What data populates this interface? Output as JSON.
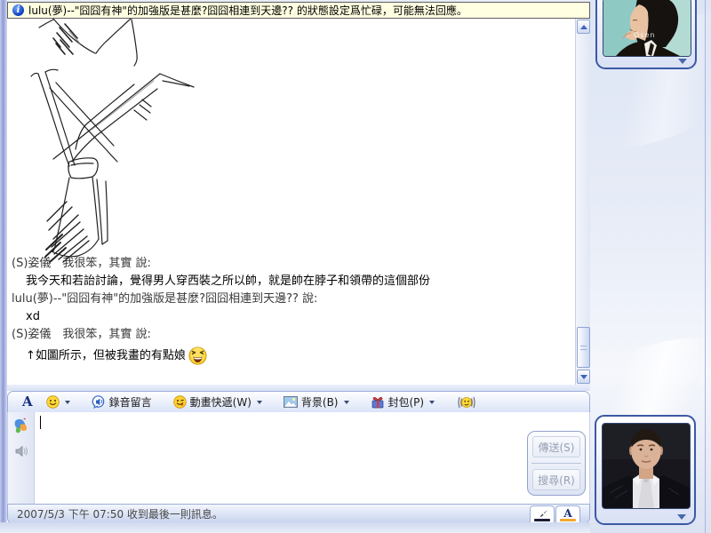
{
  "info_bar": {
    "text": "lulu(夢)--\"囧囧有神\"的加強版是甚麼?囧囧相連到天邊?? 的狀態設定爲忙碌，可能無法回應。"
  },
  "chat": {
    "messages": [
      {
        "role": "header",
        "text": "(S)姿儀　我很笨，其實 說:"
      },
      {
        "role": "body",
        "text": "我今天和若詒討論，覺得男人穿西裝之所以帥，就是帥在脖子和領帶的這個部份"
      },
      {
        "role": "header",
        "text": "lulu(夢)--\"囧囧有神\"的加強版是甚麼?囧囧相連到天邊?? 說:"
      },
      {
        "role": "body",
        "text": "xd"
      },
      {
        "role": "header",
        "text": "(S)姿儀　我很笨，其實 說:"
      },
      {
        "role": "body",
        "text": "↑如圖所示，但被我畫的有點娘",
        "emoji": "laughing-emoticon"
      }
    ]
  },
  "toolbar": {
    "font_label": "A",
    "voice_label": "錄音留言",
    "animation_label": "動畫快遞(W)",
    "background_label": "背景(B)",
    "package_label": "封包(P)"
  },
  "composer": {
    "send_label": "傳送(S)",
    "search_label": "搜尋(R)"
  },
  "status_bar": {
    "text": "2007/5/3 下午 07:50 收到最後一則訊息。",
    "text_mode_label": "A"
  },
  "avatars": {
    "top_watermark": "Osen"
  },
  "colors": {
    "info_bar_bg": "#FFFFE1",
    "panel_border": "#9CAED9",
    "text_mode_underline": "#F0A830",
    "ink_mode_underline": "#1D1D38"
  }
}
